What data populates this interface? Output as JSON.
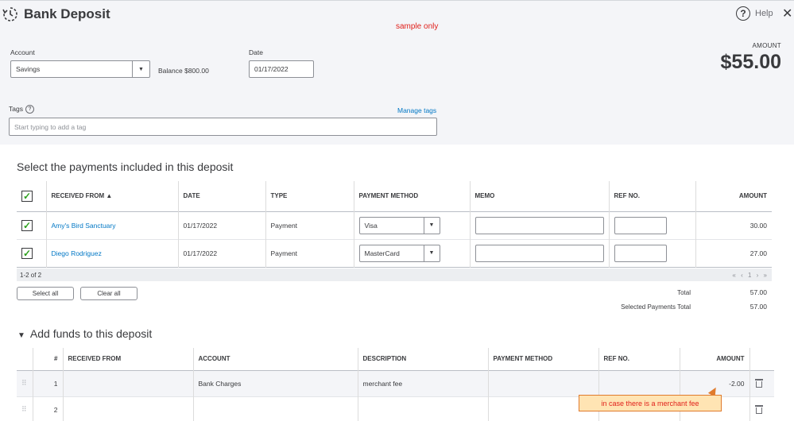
{
  "header": {
    "title": "Bank Deposit",
    "sample_note": "sample only",
    "help_label": "Help",
    "amount_label": "AMOUNT",
    "amount_value": "$55.00"
  },
  "form": {
    "account_label": "Account",
    "account_value": "Savings",
    "balance_label": "Balance",
    "balance_value": "$800.00",
    "date_label": "Date",
    "date_value": "01/17/2022",
    "tags_label": "Tags",
    "manage_tags": "Manage tags",
    "tags_placeholder": "Start typing to add a tag"
  },
  "payments": {
    "title": "Select the payments included in this deposit",
    "columns": [
      "RECEIVED FROM ▲",
      "DATE",
      "TYPE",
      "PAYMENT METHOD",
      "MEMO",
      "REF NO.",
      "AMOUNT"
    ],
    "rows": [
      {
        "received_from": "Amy's Bird Sanctuary",
        "date": "01/17/2022",
        "type": "Payment",
        "method": "Visa",
        "amount": "30.00"
      },
      {
        "received_from": "Diego Rodriguez",
        "date": "01/17/2022",
        "type": "Payment",
        "method": "MasterCard",
        "amount": "27.00"
      }
    ],
    "range": "1-2 of 2",
    "pager": "« ‹ 1 › »",
    "select_all": "Select all",
    "clear_all": "Clear all",
    "total_label": "Total",
    "total_value": "57.00",
    "selected_total_label": "Selected Payments Total",
    "selected_total_value": "57.00"
  },
  "funds": {
    "title": "Add funds to this deposit",
    "columns": [
      "#",
      "RECEIVED FROM",
      "ACCOUNT",
      "DESCRIPTION",
      "PAYMENT METHOD",
      "REF NO.",
      "AMOUNT"
    ],
    "rows": [
      {
        "num": "1",
        "received_from": "",
        "account": "Bank Charges",
        "description": "merchant fee",
        "method": "",
        "ref": "",
        "amount": "-2.00"
      },
      {
        "num": "2",
        "received_from": "",
        "account": "",
        "description": "",
        "method": "",
        "ref": "",
        "amount": ""
      }
    ],
    "callout": "in case there is a merchant fee"
  },
  "colors": {
    "accent_link": "#0077c5",
    "check_green": "#2ca01c",
    "callout_red": "#e0201b"
  }
}
